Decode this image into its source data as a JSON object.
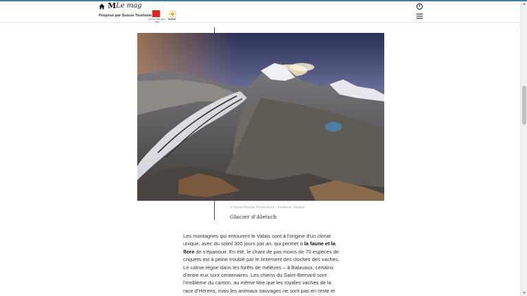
{
  "header": {
    "logo_m": "M",
    "logo_mag": "Le mag",
    "sponsor_text": "Proposé par Suisse Tourisme",
    "valais_subtitle": "ZUTTA RIBO MAG JATÉ",
    "suisse_label": "Suisse."
  },
  "icons": {
    "home": "home-icon",
    "info": "info-icon",
    "menu": "hamburger-menu-icon"
  },
  "figure": {
    "credit": "©Valais/Wallis Promotion - Frederic Huber",
    "caption": "Glacier d'Aletsch"
  },
  "article": {
    "p1_before": "Les montagnes qui entourent le Valais sont à l'origine d'un climat unique, avec du soleil 300 jours par an, qui permet à ",
    "p1_bold": "la faune et la flore",
    "p1_after": " de s'épanouir. En été, le chant de pas moins de 70 espèces de criquets est à peine troublé par le tintement des cloches des vaches. Le calme règne dans les forêts de mélèzes – à Balavaux, certains d'entre eux sont centenaires. Les chiens du Saint-Bernard sont l'emblème du canton, au même titre que les royales vaches de la race d'Hérens, mais les animaux sauvages ne sont pas en reste et les"
  },
  "colors": {
    "accent_line": "#3a7ca5",
    "valais_red": "#e2231a",
    "suisse_sun": "#f5a623"
  }
}
